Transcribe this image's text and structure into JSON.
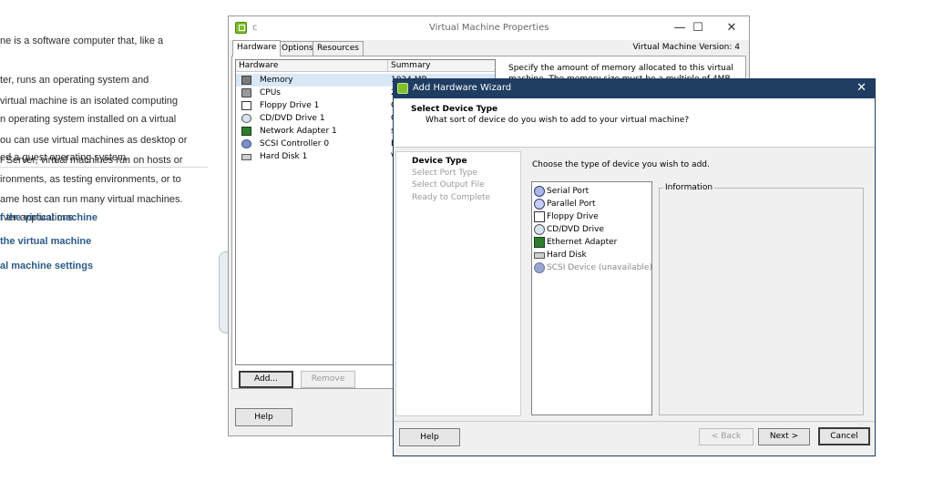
{
  "background_page": {
    "paragraphs": [
      [
        "ne is a software computer that, like a",
        "ter, runs an operating system and",
        "n operating system installed on a virtual",
        "ed a guest operating system."
      ],
      [
        "virtual machine is an isolated computing",
        "ou can use virtual machines as desktop or",
        "ironments, as testing environments, or to",
        "rver applications."
      ],
      [
        "r Server, virtual machines run on hosts or",
        "ame host can run many virtual machines."
      ]
    ],
    "tasks": [
      "f the virtual machine",
      "the virtual machine",
      "al machine settings"
    ]
  },
  "vm_properties": {
    "title_fragment": "c",
    "title": "Virtual Machine Properties",
    "tabs": [
      "Hardware",
      "Options",
      "Resources"
    ],
    "version_label": "Virtual Machine Version: 4",
    "columns": [
      "Hardware",
      "Summary"
    ],
    "hardware": [
      {
        "label": "Memory",
        "summary": "1024 MB",
        "icon": "memory-icon",
        "selected": true
      },
      {
        "label": "CPUs",
        "summary": "2",
        "icon": "cpu-icon"
      },
      {
        "label": "Floppy Drive 1",
        "summary": "C",
        "icon": "floppy-icon"
      },
      {
        "label": "CD/DVD Drive 1",
        "summary": "C",
        "icon": "cd-dvd-icon"
      },
      {
        "label": "Network Adapter 1",
        "summary": "s",
        "icon": "network-adapter-icon"
      },
      {
        "label": "SCSI Controller 0",
        "summary": "B",
        "icon": "scsi-controller-icon"
      },
      {
        "label": "Hard Disk 1",
        "summary": "V",
        "icon": "hard-disk-icon"
      }
    ],
    "description": [
      "Specify the amount of memory allocated to this virtual",
      "machine. The memory size must be a multiple of 4MB."
    ],
    "add_button": "Add...",
    "remove_button": "Remove",
    "help_button": "Help"
  },
  "wizard": {
    "title": "Add Hardware Wizard",
    "close_glyph": "✕",
    "header_title": "Select Device Type",
    "header_subtitle": "What sort of device do you wish to add to your virtual machine?",
    "steps": [
      {
        "label": "Device Type",
        "current": true
      },
      {
        "label": "Select Port Type",
        "current": false
      },
      {
        "label": "Select Output File",
        "current": false
      },
      {
        "label": "Ready to Complete",
        "current": false
      }
    ],
    "instruction": "Choose the type of device you wish to add.",
    "devices": [
      {
        "label": "Serial Port",
        "icon": "serial-port-icon"
      },
      {
        "label": "Parallel Port",
        "icon": "parallel-port-icon"
      },
      {
        "label": "Floppy Drive",
        "icon": "floppy-icon"
      },
      {
        "label": "CD/DVD Drive",
        "icon": "cd-dvd-icon"
      },
      {
        "label": "Ethernet Adapter",
        "icon": "ethernet-adapter-icon"
      },
      {
        "label": "Hard Disk",
        "icon": "hard-disk-icon"
      },
      {
        "label": "SCSI Device (unavailable)",
        "icon": "scsi-device-icon",
        "unavailable": true
      }
    ],
    "information_label": "Information",
    "help_button": "Help",
    "back_button": "< Back",
    "next_button": "Next >",
    "cancel_button": "Cancel"
  },
  "colors": {
    "wizard_titlebar": "#1f3d62",
    "task_link": "#2a5a8a",
    "selection": "#d9e8f7"
  }
}
